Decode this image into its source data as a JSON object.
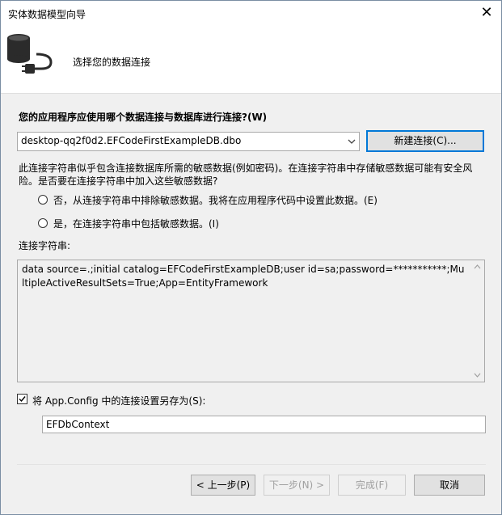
{
  "window": {
    "title": "实体数据模型向导",
    "close_glyph": "✕"
  },
  "header": {
    "title": "选择您的数据连接",
    "icon": "database-plug-icon"
  },
  "question": "您的应用程序应使用哪个数据连接与数据库进行连接?(W)",
  "connection_select": {
    "value": "desktop-qq2f0d2.EFCodeFirstExampleDB.dbo"
  },
  "new_connection_button": "新建连接(C)...",
  "sensitive_info": "此连接字符串似乎包含连接数据库所需的敏感数据(例如密码)。在连接字符串中存储敏感数据可能有安全风险。是否要在连接字符串中加入这些敏感数据?",
  "options": {
    "exclude": "否，从连接字符串中排除敏感数据。我将在应用程序代码中设置此数据。(E)",
    "include": "是，在连接字符串中包括敏感数据。(I)"
  },
  "connection_string_label": "连接字符串:",
  "connection_string": "data source=.;initial catalog=EFCodeFirstExampleDB;user id=sa;password=***********;MultipleActiveResultSets=True;App=EntityFramework",
  "save_config": {
    "label": "将 App.Config 中的连接设置另存为(S):",
    "checked": true,
    "value": "EFDbContext"
  },
  "buttons": {
    "back": "< 上一步(P)",
    "next": "下一步(N) >",
    "finish": "完成(F)",
    "cancel": "取消"
  }
}
